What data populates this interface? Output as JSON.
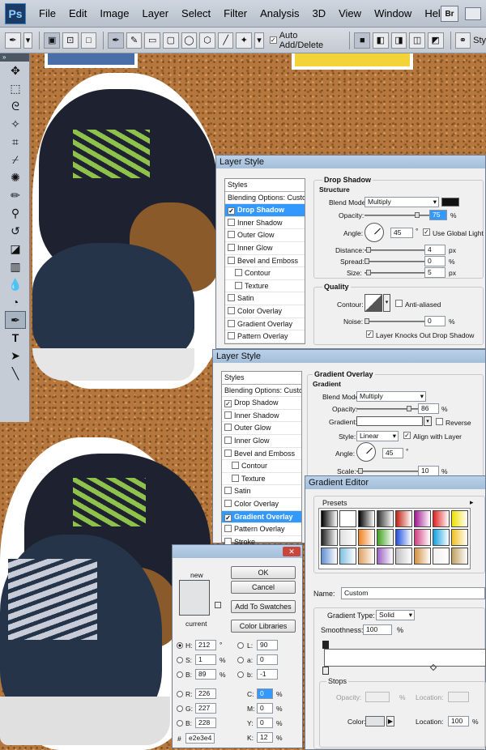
{
  "menubar": {
    "items": [
      "File",
      "Edit",
      "Image",
      "Layer",
      "Select",
      "Filter",
      "Analysis",
      "3D",
      "View",
      "Window",
      "Help"
    ],
    "logo": "Ps",
    "bridge": "Br"
  },
  "optbar": {
    "auto_add_delete": "Auto Add/Delete",
    "style_trunc": "Sty"
  },
  "layer_style_1": {
    "title": "Layer Style",
    "list": [
      "Styles",
      "Blending Options: Custom",
      "Drop Shadow",
      "Inner Shadow",
      "Outer Glow",
      "Inner Glow",
      "Bevel and Emboss",
      "Contour",
      "Texture",
      "Satin",
      "Color Overlay",
      "Gradient Overlay",
      "Pattern Overlay"
    ],
    "section": "Drop Shadow",
    "structure": "Structure",
    "blend_mode_label": "Blend Mode:",
    "blend_mode": "Multiply",
    "opacity_label": "Opacity:",
    "opacity": "75",
    "pct": "%",
    "angle_label": "Angle:",
    "angle": "45",
    "deg": "°",
    "global_light": "Use Global Light",
    "distance_label": "Distance:",
    "distance": "4",
    "spread_label": "Spread:",
    "spread": "0",
    "size_label": "Size:",
    "size": "5",
    "px": "px",
    "quality": "Quality",
    "contour_label": "Contour:",
    "antialiased": "Anti-aliased",
    "noise_label": "Noise:",
    "noise": "0",
    "knocks_out": "Layer Knocks Out Drop Shadow"
  },
  "layer_style_2": {
    "title": "Layer Style",
    "list": [
      "Styles",
      "Blending Options: Custom",
      "Drop Shadow",
      "Inner Shadow",
      "Outer Glow",
      "Inner Glow",
      "Bevel and Emboss",
      "Contour",
      "Texture",
      "Satin",
      "Color Overlay",
      "Gradient Overlay",
      "Pattern Overlay",
      "Stroke"
    ],
    "section": "Gradient Overlay",
    "sub": "Gradient",
    "blend_mode_label": "Blend Mode:",
    "blend_mode": "Multiply",
    "opacity_label": "Opacity:",
    "opacity": "86",
    "gradient_label": "Gradient:",
    "reverse": "Reverse",
    "style_label": "Style:",
    "style": "Linear",
    "align_layer": "Align with Layer",
    "angle_label": "Angle:",
    "angle": "45",
    "scale_label": "Scale:",
    "scale": "10"
  },
  "gradient_editor": {
    "title": "Gradient Editor",
    "presets": "Presets",
    "name_label": "Name:",
    "name": "Custom",
    "type_label": "Gradient Type:",
    "type": "Solid",
    "smoothness_label": "Smoothness:",
    "smoothness": "100",
    "stops": "Stops",
    "opacity_label": "Opacity:",
    "location_label": "Location:",
    "color_label": "Color:",
    "location": "100",
    "pct": "%",
    "swatch_colors": [
      "#000000",
      "#ffffff",
      "#000000",
      "#303030",
      "#c02010",
      "#a01890",
      "#e02020",
      "#f0e000",
      "#202020",
      "#e0e0e0",
      "#f08020",
      "#40a020",
      "#2050e0",
      "#d04080",
      "#10a0e0",
      "#f0c020",
      "#6090d0",
      "#80c0e0",
      "#e0a060",
      "#9a60c0",
      "#c0c0c0",
      "#d09040",
      "#f0f0f0",
      "#c0a060"
    ]
  },
  "color_picker": {
    "new": "new",
    "current": "current",
    "ok": "OK",
    "cancel": "Cancel",
    "add_swatches": "Add To Swatches",
    "libraries": "Color Libraries",
    "h_label": "H:",
    "h": "212",
    "deg": "°",
    "s_label": "S:",
    "s": "1",
    "b_label": "B:",
    "b": "89",
    "pct": "%",
    "l_label": "L:",
    "l": "90",
    "a_label": "a:",
    "a": "0",
    "bb_label": "b:",
    "bb": "-1",
    "r_label": "R:",
    "r": "226",
    "g_label": "G:",
    "g": "227",
    "bl_label": "B:",
    "bl": "228",
    "c_label": "C:",
    "c": "0",
    "m_label": "M:",
    "m": "0",
    "y_label": "Y:",
    "y": "0",
    "k_label": "K:",
    "k": "12",
    "hash": "#",
    "hex": "e2e3e4",
    "swatch": "#e2e3e4"
  }
}
